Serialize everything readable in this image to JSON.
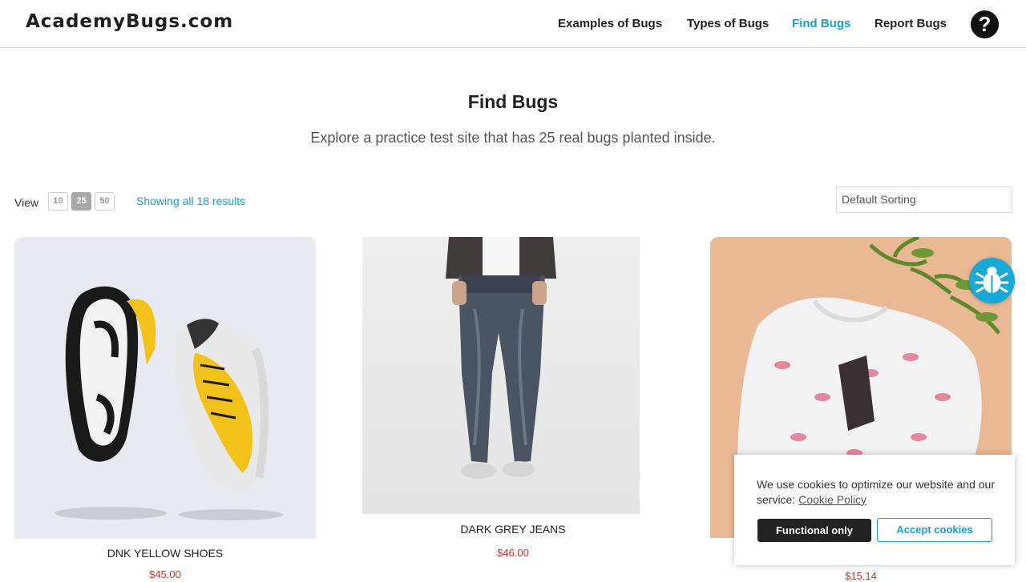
{
  "header": {
    "logo": "AcademyBugs.com",
    "nav": {
      "examples": "Examples of Bugs",
      "types": "Types of Bugs",
      "find": "Find Bugs",
      "report": "Report Bugs"
    },
    "help_icon": "question-circle-icon",
    "help_glyph": "?"
  },
  "page": {
    "title": "Find Bugs",
    "subtitle": "Explore a practice test site that has 25 real bugs planted inside."
  },
  "toolbar": {
    "view_label": "View",
    "page_sizes": [
      "10",
      "25",
      "50"
    ],
    "selected_page_size": "25",
    "results_text": "Showing all 18 results",
    "sorting_value": "Default Sorting"
  },
  "products": [
    {
      "name": "DNK YELLOW SHOES",
      "price": "$45.00"
    },
    {
      "name": "DARK GREY JEANS",
      "price": "$46.00"
    },
    {
      "name": "",
      "price": "$15.14"
    }
  ],
  "cookie": {
    "text": "We use cookies to optimize our website and our service:",
    "policy_link": "Cookie Policy",
    "functional_button": "Functional only",
    "accept_button": "Accept cookies"
  },
  "colors": {
    "accent": "#1a9cc6",
    "price": "#c0392b",
    "bug_fab": "#18aad6"
  },
  "icons": {
    "floating_button": "bug-icon"
  }
}
